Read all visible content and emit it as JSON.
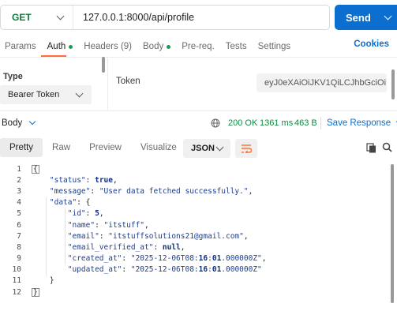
{
  "request": {
    "method": "GET",
    "url": "127.0.0.1:8000/api/profile",
    "send_label": "Send"
  },
  "tabs": [
    {
      "label": "Params",
      "dot": false
    },
    {
      "label": "Auth",
      "dot": true
    },
    {
      "label": "Headers (9)",
      "dot": false
    },
    {
      "label": "Body",
      "dot": true
    },
    {
      "label": "Pre-req.",
      "dot": false
    },
    {
      "label": "Tests",
      "dot": false
    },
    {
      "label": "Settings",
      "dot": false
    }
  ],
  "cookies_label": "Cookies",
  "auth": {
    "type_label": "Type",
    "type_value": "Bearer Token",
    "token_label": "Token",
    "token_value": "eyJ0eXAiOiJKV1QiLCJhbGciOi ..."
  },
  "response": {
    "body_label": "Body",
    "status": "200 OK",
    "time": "1361 ms",
    "size": "463 B",
    "save_label": "Save Response",
    "formats": [
      "Pretty",
      "Raw",
      "Preview",
      "Visualize"
    ],
    "active_format": "Pretty",
    "language": "JSON"
  },
  "colors": {
    "accent": "#0b6fcf",
    "method": "#0e7b3c",
    "status_ok": "#0e8a42",
    "active_tab_underline": "#ff6c37"
  },
  "code_lines": [
    "{",
    "    \"status\": true,",
    "    \"message\": \"User data fetched successfully.\",",
    "    \"data\": {",
    "        \"id\": 5,",
    "        \"name\": \"itstuff\",",
    "        \"email\": \"itstuffsolutions21@gmail.com\",",
    "        \"email_verified_at\": null,",
    "        \"created_at\": \"2025-12-06T08:16:01.000000Z\",",
    "        \"updated_at\": \"2025-12-06T08:16:01.000000Z\"",
    "    }",
    "}"
  ]
}
